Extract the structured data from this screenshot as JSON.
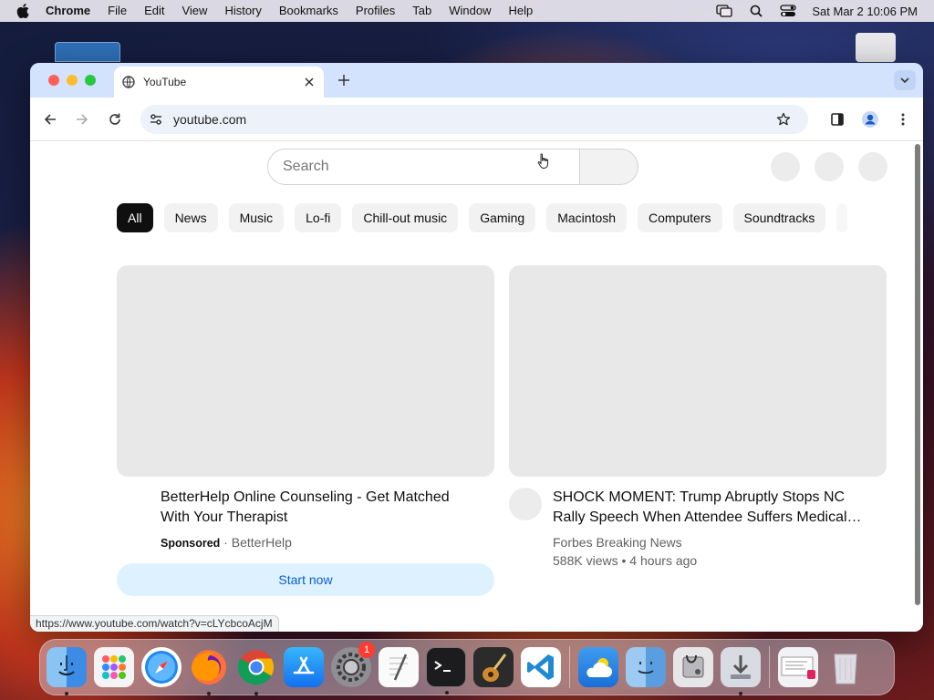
{
  "menubar": {
    "app_name": "Chrome",
    "menus": [
      "File",
      "Edit",
      "View",
      "History",
      "Bookmarks",
      "Profiles",
      "Tab",
      "Window",
      "Help"
    ],
    "clock": "Sat Mar 2  10:06 PM"
  },
  "browser": {
    "tab_title": "YouTube",
    "url": "youtube.com",
    "status_url": "https://www.youtube.com/watch?v=cLYcbcoAcjM"
  },
  "youtube": {
    "search_placeholder": "Search",
    "chips": [
      "All",
      "News",
      "Music",
      "Lo-fi",
      "Chill-out music",
      "Gaming",
      "Macintosh",
      "Computers",
      "Soundtracks"
    ],
    "videos": [
      {
        "title": "BetterHelp Online Counseling - Get Matched With Your Therapist",
        "sponsored_label": "Sponsored",
        "separator": " · ",
        "channel": "BetterHelp",
        "cta": "Start now"
      },
      {
        "title": "SHOCK MOMENT: Trump Abruptly Stops NC Rally Speech When Attendee Suffers Medical…",
        "channel": "Forbes Breaking News",
        "stats": "588K views • 4 hours ago"
      }
    ]
  },
  "dock": {
    "apps": [
      "finder-icon",
      "launchpad-icon",
      "safari-icon",
      "firefox-icon",
      "chrome-icon",
      "app-store-icon",
      "system-settings-icon",
      "textedit-icon",
      "terminal-icon",
      "garageband-icon",
      "vscode-icon",
      "weather-icon",
      "migration-assistant-icon",
      "disk-utility-icon",
      "downloads-icon",
      "preview-icon",
      "trash-icon"
    ],
    "settings_badge": "1"
  },
  "colors": {
    "tabstrip": "#d3e3fd",
    "chip_active": "#0f0f0f",
    "cta_background": "#def1ff",
    "cta_text": "#065fd4"
  }
}
